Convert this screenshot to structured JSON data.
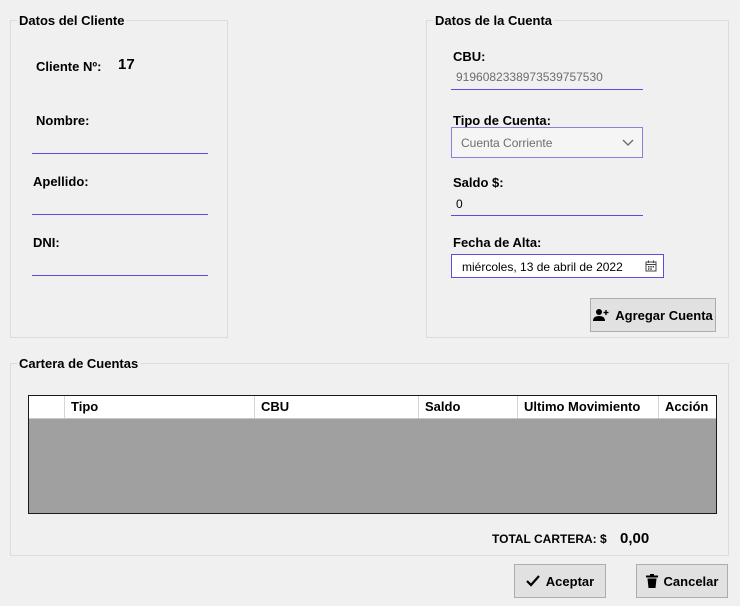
{
  "cliente": {
    "title": "Datos del Cliente",
    "numero_label": "Cliente Nº:",
    "numero_value": "17",
    "nombre_label": "Nombre:",
    "apellido_label": "Apellido:",
    "dni_label": "DNI:"
  },
  "cuenta": {
    "title": "Datos de la Cuenta",
    "cbu_label": "CBU:",
    "cbu_value": "9196082338973539757530",
    "tipo_label": "Tipo de Cuenta:",
    "tipo_value": "Cuenta Corriente",
    "saldo_label": "Saldo $:",
    "saldo_value": "0",
    "fecha_label": "Fecha de Alta:",
    "fecha_value": "miércoles, 13 de abril de 2022",
    "agregar_label": "Agregar Cuenta"
  },
  "cartera": {
    "title": "Cartera de Cuentas",
    "columns": [
      "Tipo",
      "CBU",
      "Saldo",
      "Ultimo Movimiento",
      "Acción"
    ],
    "total_label": "TOTAL CARTERA: $",
    "total_value": "0,00"
  },
  "footer": {
    "aceptar_label": "Aceptar",
    "cancelar_label": "Cancelar"
  },
  "icons": {
    "calendar": "calendar-icon",
    "add_user": "add-user-icon",
    "check": "check-icon",
    "trash": "trash-icon",
    "chevron": "chevron-down-icon"
  },
  "colors": {
    "accent": "#5b4ed8",
    "grid_empty": "#a0a0a0",
    "background": "#f0f0f0"
  }
}
